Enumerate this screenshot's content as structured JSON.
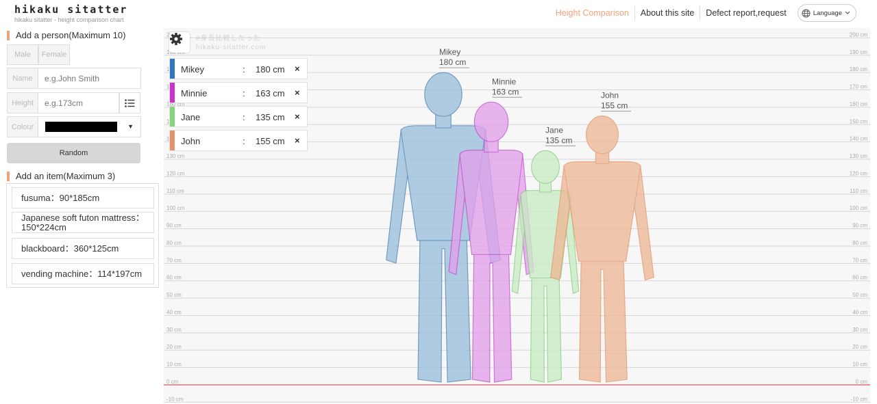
{
  "brand": {
    "title": "hikaku sitatter",
    "subtitle": "hikaku sitatter - height comparison chart"
  },
  "nav": {
    "height_comparison": "Height Comparison",
    "about": "About this site",
    "report": "Defect report,request",
    "language": "Language"
  },
  "add_person": {
    "heading": "Add a person(Maximum 10)",
    "gender": {
      "male": "Male",
      "female": "Female"
    },
    "name": {
      "label": "Name",
      "placeholder": "e.g.John Smith"
    },
    "height": {
      "label": "Height",
      "placeholder": "e.g.173cm"
    },
    "colour": {
      "label": "Colour",
      "value": "#000000"
    },
    "random_button": "Random"
  },
  "add_item": {
    "heading": "Add an item(Maximum 3)",
    "items": [
      "fusuma：90*185cm",
      "Japanese soft futon mattress：150*224cm",
      "blackboard：360*125cm",
      "vending machine：114*197cm"
    ]
  },
  "watermark": {
    "line1": "#身長比較したった",
    "line2": "hikaku-sitatter.com"
  },
  "people": [
    {
      "name": "Mikey",
      "height_cm": 180,
      "height_text": "180 cm",
      "color": "#2d77bf",
      "fill": "#9cbfdd",
      "stroke": "#4a82b6"
    },
    {
      "name": "Minnie",
      "height_cm": 163,
      "height_text": "163 cm",
      "color": "#cc33cc",
      "fill": "#e2a0ea",
      "stroke": "#c34fcf"
    },
    {
      "name": "Jane",
      "height_cm": 135,
      "height_text": "135 cm",
      "color": "#85d67c",
      "fill": "#c8ecc4",
      "stroke": "#8acf82"
    },
    {
      "name": "John",
      "height_cm": 155,
      "height_text": "155 cm",
      "color": "#e4946a",
      "fill": "#eeb996",
      "stroke": "#e0966c"
    }
  ],
  "scale": {
    "min_cm": -10,
    "max_cm": 200,
    "step_cm": 10,
    "unit": "cm"
  }
}
